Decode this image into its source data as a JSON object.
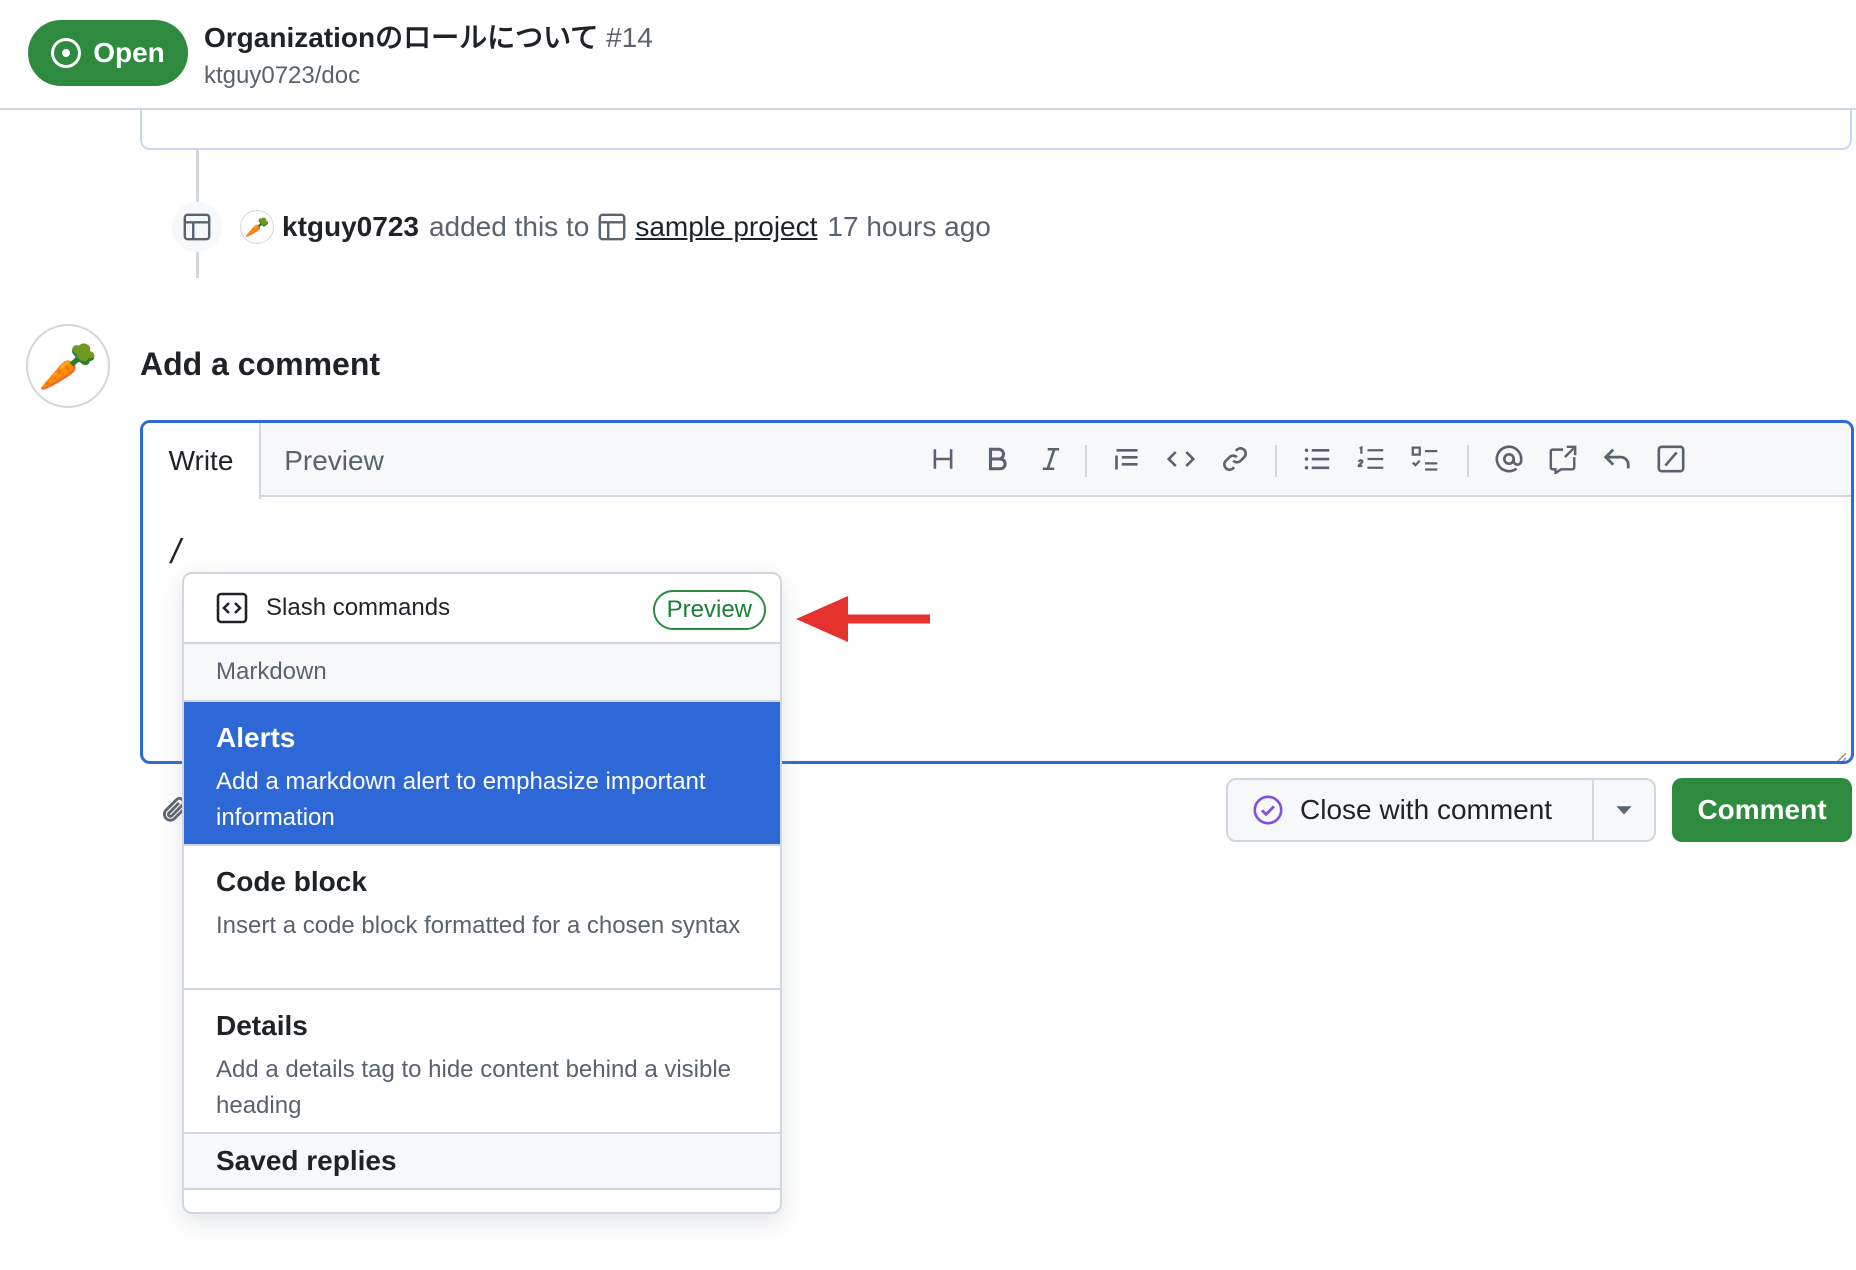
{
  "header": {
    "state": "Open",
    "title": "Organizationのロールについて",
    "number": "#14",
    "repo": "ktguy0723/doc"
  },
  "timeline": {
    "event_author": "ktguy0723",
    "event_action": "added this to",
    "project_name": "sample project",
    "time_ago": "17 hours ago"
  },
  "comment_form": {
    "heading": "Add a comment",
    "tabs": {
      "write": "Write",
      "preview": "Preview"
    },
    "typed_text": "/",
    "toolbar_icons": [
      "heading-icon",
      "bold-icon",
      "italic-icon",
      "quote-icon",
      "code-icon",
      "link-icon",
      "unordered-list-icon",
      "ordered-list-icon",
      "task-list-icon",
      "mention-icon",
      "reference-icon",
      "saved-reply-icon",
      "slash-command-icon"
    ]
  },
  "slash_menu": {
    "title": "Slash commands",
    "badge": "Preview",
    "group_markdown": "Markdown",
    "items": [
      {
        "title": "Alerts",
        "description": "Add a markdown alert to emphasize important information",
        "selected": true
      },
      {
        "title": "Code block",
        "description": "Insert a code block formatted for a chosen syntax",
        "selected": false
      },
      {
        "title": "Details",
        "description": "Add a details tag to hide content behind a visible heading",
        "selected": false
      }
    ],
    "group_saved": "Saved replies"
  },
  "actions": {
    "close_label": "Close with comment",
    "comment_label": "Comment"
  },
  "colors": {
    "open_green": "#2d8a3e",
    "focus_blue": "#2d6ad3",
    "selected_blue": "#2d68d6",
    "arrow_red": "#e5322d",
    "close_purple": "#8250df"
  }
}
